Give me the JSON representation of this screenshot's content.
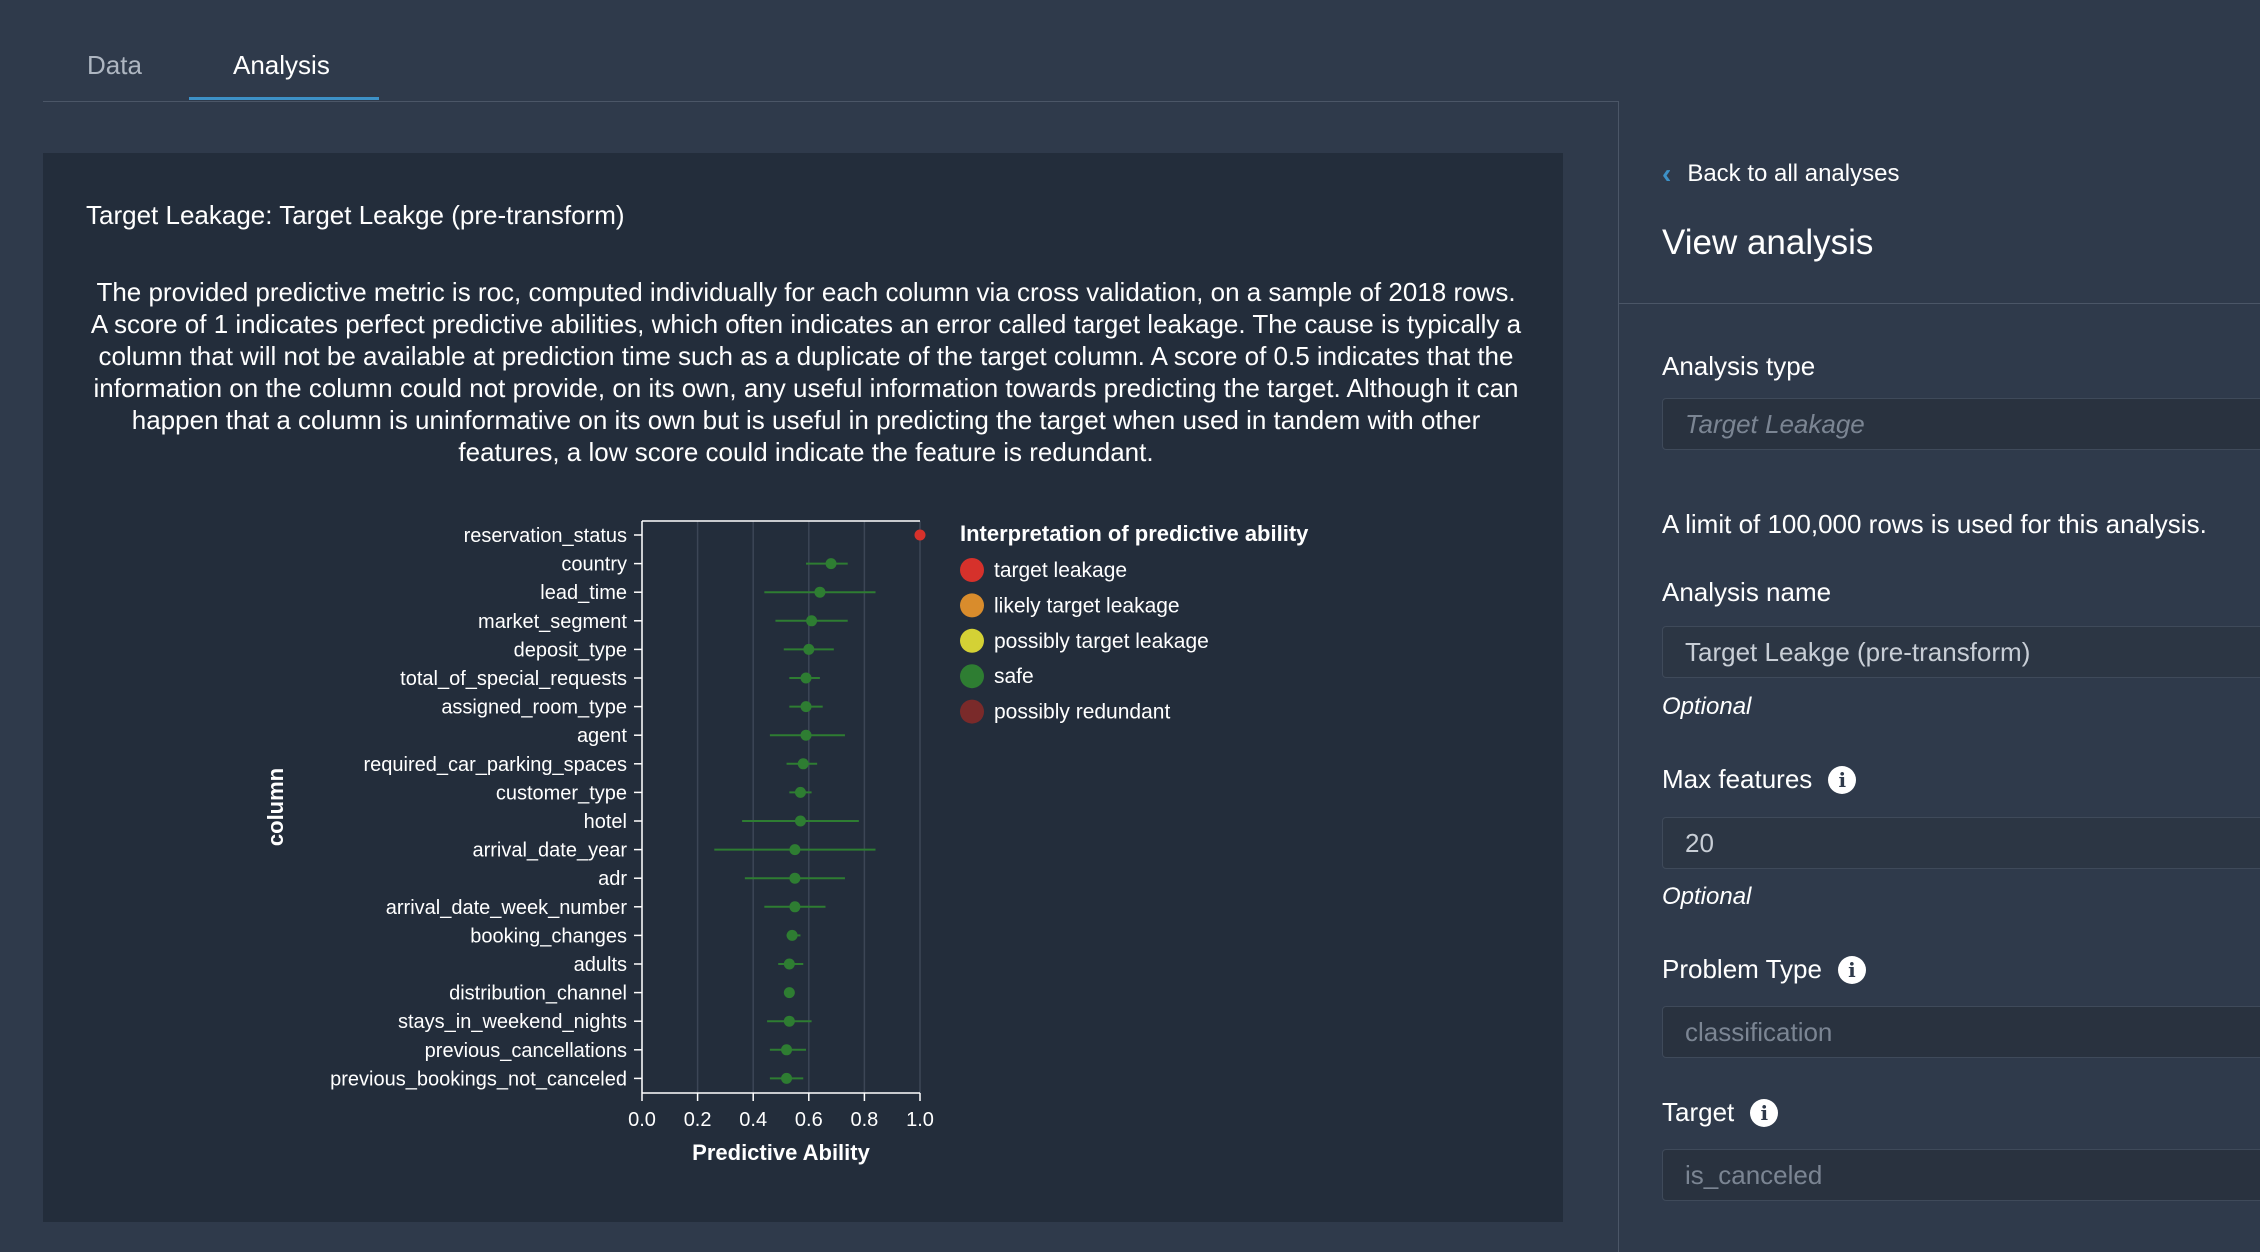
{
  "tabs": [
    {
      "label": "Data"
    },
    {
      "label": "Analysis"
    }
  ],
  "panel": {
    "title": "Target Leakage: Target Leakge (pre-transform)",
    "description": "The provided predictive metric is roc, computed individually for each column via cross validation, on a sample of 2018 rows. A score of 1 indicates perfect predictive abilities, which often indicates an error called target leakage. The cause is typically a column that will not be available at prediction time such as a duplicate of the target column. A score of 0.5 indicates that the information on the column could not provide, on its own, any useful information towards predicting the target. Although it can happen that a column is uninformative on its own but is useful in predicting the target when used in tandem with other features, a low score could indicate the feature is redundant."
  },
  "chart_data": {
    "type": "scatter",
    "xlabel": "Predictive Ability",
    "ylabel": "column",
    "xlim": [
      0.0,
      1.0
    ],
    "xticks": [
      "0.0",
      "0.2",
      "0.4",
      "0.6",
      "0.8",
      "1.0"
    ],
    "grid": true,
    "legend_position": "right",
    "legend_title": "Interpretation of predictive ability",
    "legend": [
      {
        "label": "target leakage",
        "color": "#d6312b"
      },
      {
        "label": "likely target leakage",
        "color": "#d98c2c"
      },
      {
        "label": "possibly target leakage",
        "color": "#d4d135"
      },
      {
        "label": "safe",
        "color": "#2e7d32"
      },
      {
        "label": "possibly redundant",
        "color": "#7a2a2a"
      }
    ],
    "points": [
      {
        "column": "reservation_status",
        "value": 1.0,
        "low": 1.0,
        "high": 1.0,
        "category": "target leakage"
      },
      {
        "column": "country",
        "value": 0.68,
        "low": 0.59,
        "high": 0.74,
        "category": "safe"
      },
      {
        "column": "lead_time",
        "value": 0.64,
        "low": 0.44,
        "high": 0.84,
        "category": "safe"
      },
      {
        "column": "market_segment",
        "value": 0.61,
        "low": 0.48,
        "high": 0.74,
        "category": "safe"
      },
      {
        "column": "deposit_type",
        "value": 0.6,
        "low": 0.51,
        "high": 0.69,
        "category": "safe"
      },
      {
        "column": "total_of_special_requests",
        "value": 0.59,
        "low": 0.53,
        "high": 0.64,
        "category": "safe"
      },
      {
        "column": "assigned_room_type",
        "value": 0.59,
        "low": 0.53,
        "high": 0.65,
        "category": "safe"
      },
      {
        "column": "agent",
        "value": 0.59,
        "low": 0.46,
        "high": 0.73,
        "category": "safe"
      },
      {
        "column": "required_car_parking_spaces",
        "value": 0.58,
        "low": 0.52,
        "high": 0.63,
        "category": "safe"
      },
      {
        "column": "customer_type",
        "value": 0.57,
        "low": 0.53,
        "high": 0.61,
        "category": "safe"
      },
      {
        "column": "hotel",
        "value": 0.57,
        "low": 0.36,
        "high": 0.78,
        "category": "safe"
      },
      {
        "column": "arrival_date_year",
        "value": 0.55,
        "low": 0.26,
        "high": 0.84,
        "category": "safe"
      },
      {
        "column": "adr",
        "value": 0.55,
        "low": 0.37,
        "high": 0.73,
        "category": "safe"
      },
      {
        "column": "arrival_date_week_number",
        "value": 0.55,
        "low": 0.44,
        "high": 0.66,
        "category": "safe"
      },
      {
        "column": "booking_changes",
        "value": 0.54,
        "low": 0.52,
        "high": 0.57,
        "category": "safe"
      },
      {
        "column": "adults",
        "value": 0.53,
        "low": 0.49,
        "high": 0.58,
        "category": "safe"
      },
      {
        "column": "distribution_channel",
        "value": 0.53,
        "low": 0.52,
        "high": 0.54,
        "category": "safe"
      },
      {
        "column": "stays_in_weekend_nights",
        "value": 0.53,
        "low": 0.45,
        "high": 0.61,
        "category": "safe"
      },
      {
        "column": "previous_cancellations",
        "value": 0.52,
        "low": 0.46,
        "high": 0.59,
        "category": "safe"
      },
      {
        "column": "previous_bookings_not_canceled",
        "value": 0.52,
        "low": 0.46,
        "high": 0.58,
        "category": "safe"
      }
    ]
  },
  "side": {
    "back_label": "Back to all analyses",
    "title": "View analysis",
    "analysis_type_label": "Analysis type",
    "analysis_type_value": "Target Leakage",
    "limit_note": "A limit of 100,000 rows is used for this analysis.",
    "analysis_name_label": "Analysis name",
    "analysis_name_value": "Target Leakge (pre-transform)",
    "optional": "Optional",
    "max_features_label": "Max features",
    "max_features_value": "20",
    "problem_type_label": "Problem Type",
    "problem_type_value": "classification",
    "target_label": "Target",
    "target_value": "is_canceled"
  },
  "colors": {
    "accent": "#3d91c7",
    "panel": "#232d3b",
    "background": "#2f3a4b",
    "point": "#2e7d32",
    "leakage": "#d6312b"
  }
}
